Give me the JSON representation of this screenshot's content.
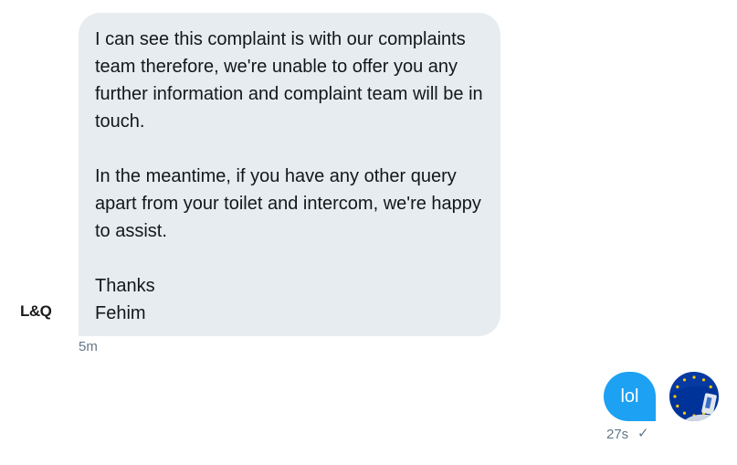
{
  "conversation": {
    "incoming": {
      "sender_logo_text": "L&Q",
      "paragraphs": [
        "I can see this complaint is with our complaints team therefore, we're unable to offer you any further information and complaint team will be in touch.",
        "In the meantime, if you have any other query apart from your toilet and intercom, we're happy to assist.",
        "Thanks",
        "Fehim"
      ],
      "timestamp": "5m"
    },
    "outgoing": {
      "text": "lol",
      "timestamp": "27s",
      "status_icon": "sent-check-icon",
      "avatar_icon": "eu-flag-avatar"
    }
  },
  "colors": {
    "incoming_bubble": "#e6ecf0",
    "outgoing_bubble": "#1da1f2",
    "meta_text": "#657786",
    "avatar_blue": "#003399",
    "avatar_stars": "#ffcc00"
  }
}
